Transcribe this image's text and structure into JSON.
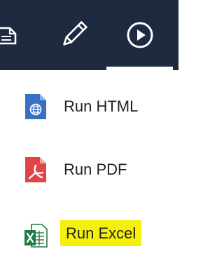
{
  "toolbar": {
    "tools": [
      {
        "icon": "document-icon"
      },
      {
        "icon": "pencil-icon"
      },
      {
        "icon": "play-circle-icon",
        "active": true
      }
    ],
    "background_color": "#1d2a3f"
  },
  "menu": {
    "items": [
      {
        "label": "Run HTML",
        "icon": "html-globe-icon",
        "icon_color": "#3a6fc4"
      },
      {
        "label": "Run PDF",
        "icon": "pdf-icon",
        "icon_color": "#e04545"
      },
      {
        "label": "Run Excel",
        "icon": "excel-icon",
        "icon_color": "#1f7a45",
        "highlighted": true,
        "highlight_color": "#f5f00a"
      }
    ]
  }
}
